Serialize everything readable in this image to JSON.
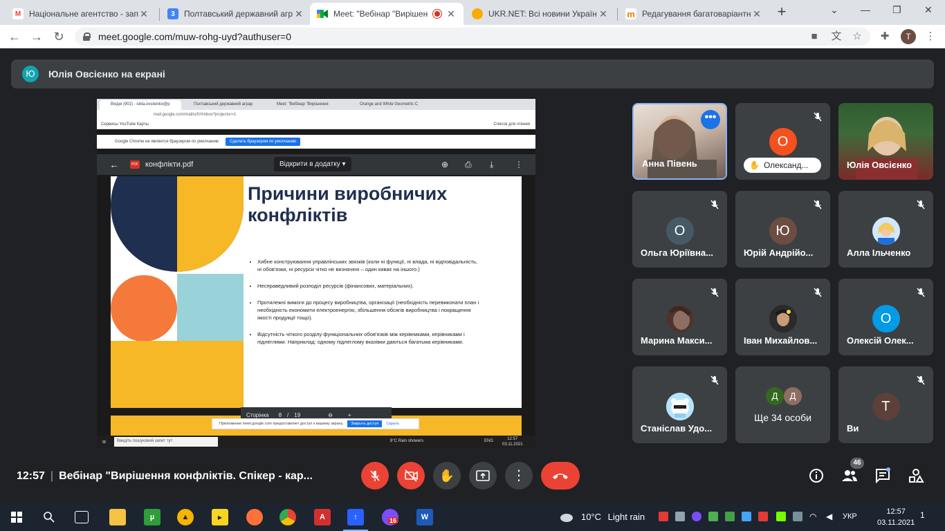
{
  "browser": {
    "tabs": [
      {
        "title": "Національне агентство - зап",
        "favicon_color": "#ea4335",
        "favicon": "M"
      },
      {
        "title": "Полтавський державний агр",
        "favicon_color": "#4285f4",
        "favicon": "3"
      },
      {
        "title": "Meet: \"Вебінар \"Вирішен",
        "favicon_color": "#00897b",
        "favicon": ""
      },
      {
        "title": "UKR.NET: Всі новини Україн",
        "favicon_color": "#f9ab00",
        "favicon": ""
      },
      {
        "title": "Редагування багатоваріантн",
        "favicon_color": "#f57c00",
        "favicon": "m"
      }
    ],
    "new_tab": "+",
    "url": "meet.google.com/muw-rohg-uyd?authuser=0",
    "profile_initial": "T"
  },
  "meet": {
    "presenter_initial": "Ю",
    "presenter_label": "Юлія Овсієнко на екрані",
    "time": "12:57",
    "meeting_title": "Вебінар \"Вирішення конфліктів. Спікер - кар...",
    "participants_count": "46",
    "participants": [
      {
        "name": "Анна Півень",
        "type": "video"
      },
      {
        "name": "Олександ...",
        "initial": "О",
        "color": "#f4511e",
        "type": "hand"
      },
      {
        "name": "Юлія Овсієнко",
        "type": "video"
      },
      {
        "name": "Ольга Юріївна...",
        "initial": "О",
        "color": "#455a64"
      },
      {
        "name": "Юрій Андрійо...",
        "initial": "Ю",
        "color": "#6d4c41"
      },
      {
        "name": "Алла Ільченко",
        "initial": "",
        "color": "#ffd180"
      },
      {
        "name": "Марина Макси...",
        "initial": "",
        "color": "#5d4037"
      },
      {
        "name": "Іван Михайлов...",
        "initial": "",
        "color": "#3e2723"
      },
      {
        "name": "Олексій Олек...",
        "initial": "О",
        "color": "#039be5"
      },
      {
        "name": "Станіслав Удо...",
        "initial": "",
        "color": "#b3e5fc"
      },
      {
        "name": "Ще 34 особи",
        "type": "others",
        "a1": "Д",
        "a2": "Д"
      },
      {
        "name": "Ви",
        "initial": "Т",
        "color": "#5d4037"
      }
    ]
  },
  "shared": {
    "inner_tabs": [
      "Вхідні (902) - iuliia.ovsiienko@p",
      "Полтавський державний аграр",
      "Meet: \"Вебінар \"Вирішення",
      "Orange and White Geometric C"
    ],
    "inner_url": "mail.google.com/mail/u/0/#inbox?projector=1",
    "bookmarks": "Сервисы   YouTube   Карты",
    "reading_list": "Список для чтения",
    "chrome_notice": "Google Chrome не является браузером по умолчанию",
    "chrome_button": "Сделать браузером по умолчанию",
    "pdf_name": "конфлікти.pdf",
    "pdf_open": "Відкрити в додатку",
    "slide_title": "Причини виробничих конфліктів",
    "bullets": [
      "Хибне конструювання управлінських звязків (коли ні функції, ні влада, ні відповідальність, ні обов'язки, ні ресурси чітко не визначені – один киває на іншого.)",
      "Несправедливий розподіл ресурсів (фінансових, матеріальних).",
      "Протилежні вимоги до процесу виробництва, організації (необхідність перевиконати план і необхідність економити електроенергію, збільшення обсягів виробництва і покращення якості продукції тощо).",
      "Відсутність чіткого розділу функціональних обов'язків між керівниками, керівниками і підлеглими. Наприклад: одному підлеглому вказівки даються багатьма керівниками."
    ],
    "pager_label": "Сторінка",
    "pager_page": "8",
    "pager_total": "19",
    "allow_notice": "Приложение meet.google.com предоставляет доступ к вашему экрану.",
    "allow_button": "Закрыть доступ",
    "hide_button": "Скрыть",
    "inner_search": "Введіть пошуковий запит тут",
    "inner_weather": "8°C  Rain showers",
    "inner_lang": "ENG",
    "inner_time": "12:57",
    "inner_date": "03.11.2021"
  },
  "taskbar": {
    "weather_temp": "10°C",
    "weather_text": "Light rain",
    "lang": "УКР",
    "time": "12:57",
    "date": "03.11.2021",
    "viber_badge": "16",
    "notifications": "1"
  },
  "colors": {
    "meet_bg": "#202124",
    "tile_bg": "#3c4043",
    "end_red": "#ea4335",
    "slide_navy": "#1f2f4f",
    "slide_yellow": "#f6b826",
    "slide_orange": "#f5793a",
    "slide_teal": "#99d3d9"
  }
}
